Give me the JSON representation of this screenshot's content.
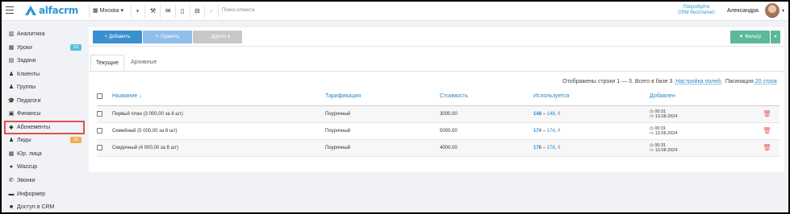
{
  "header": {
    "logo_text": "alfacrm",
    "branch": "Москва",
    "branch_caret": "▾",
    "search_placeholder": "Поиск клиента",
    "promo_line1": "Попробуйте",
    "promo_line2": "CRM бесплатно!",
    "user_name": "Александра",
    "user_caret": "▾",
    "icons": [
      "plus-icon",
      "wrench-icon",
      "envelope-icon",
      "mobile-icon",
      "cart-icon",
      "bell-icon"
    ]
  },
  "sidebar": {
    "items": [
      {
        "label": "Аналитика",
        "icon": "▥"
      },
      {
        "label": "Уроки",
        "icon": "▦",
        "badge": "12",
        "badge_color": "#5bc0de"
      },
      {
        "label": "Задачи",
        "icon": "▤"
      },
      {
        "label": "Клиенты",
        "icon": "♟"
      },
      {
        "label": "Группы",
        "icon": "♟"
      },
      {
        "label": "Педагоги",
        "icon": "🎓"
      },
      {
        "label": "Финансы",
        "icon": "▣"
      },
      {
        "label": "Абонементы",
        "icon": "◆"
      },
      {
        "label": "Лиды",
        "icon": "♟",
        "badge": "23",
        "badge_color": "#f0ad4e"
      },
      {
        "label": "Юр. лица",
        "icon": "▦"
      },
      {
        "label": "Wazzup",
        "icon": "●"
      },
      {
        "label": "Звонки",
        "icon": "✆"
      },
      {
        "label": "Информер",
        "icon": "▬"
      },
      {
        "label": "Доступ в CRM",
        "icon": "■"
      }
    ]
  },
  "toolbar": {
    "add_label": "+ Добавить",
    "edit_label": "✎ Править",
    "other_label": "⋯ Другое ▾",
    "filter_label": "▼ Фильтр",
    "filter_caret": "▾"
  },
  "tabs": {
    "current": "Текущие",
    "archived": "Архивные"
  },
  "info": {
    "rows_text": "Отображены строки 1 — 3. Всего в базе 3.",
    "settings_link": "Настройка полей.",
    "pagination_label": "Пагинация",
    "pagination_value": "20 строк"
  },
  "table": {
    "headers": {
      "name": "Название ↓",
      "tariff": "Тарификация",
      "cost": "Стоимость",
      "used": "Используется",
      "added": "Добавлен"
    },
    "rows": [
      {
        "name": "Первый план (3 000,00 за 8 шт)",
        "tariff": "Поурочный",
        "cost": "3000.00",
        "used_a": "148",
        "used_b": "148",
        "theta": "θ",
        "time": "00:31",
        "date": "13.08.2024"
      },
      {
        "name": "Семейный (5 000,00 за 8 шт)",
        "tariff": "Поурочный",
        "cost": "5000.00",
        "used_a": "174",
        "used_b": "174",
        "theta": "θ",
        "time": "00:31",
        "date": "13.08.2024"
      },
      {
        "name": "Скидочный (4 000,00 за 8 шт)",
        "tariff": "Поурочный",
        "cost": "4000.00",
        "used_a": "178",
        "used_b": "178",
        "theta": "θ",
        "time": "00:31",
        "date": "13.08.2024"
      }
    ],
    "dash": "–",
    "clock": "◷",
    "calendar": "▭",
    "trash": "🗑"
  }
}
